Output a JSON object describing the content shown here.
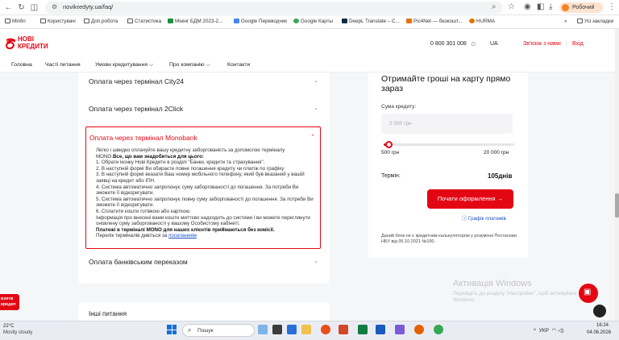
{
  "browser": {
    "url": "novikredyty.ua/faq/",
    "profile_label": "Робочий",
    "bookmarks": [
      "Minfin",
      "Користувачі",
      "Доп.робота",
      "Статистика",
      "Мінінг БДМ 2023-2...",
      "Google Переводчик",
      "Google Карты",
      "DeepL Translate – C...",
      "Pic4Net — безкошт...",
      "HURMA"
    ],
    "bookmarks_more": "»",
    "all_bookmarks": "Усі закладки"
  },
  "site": {
    "logo_line1": "НОВІ",
    "logo_line2": "КРЕДИТИ",
    "phone": "0 800 301 008",
    "lang": "UA",
    "contact": "Зв'язок з нами",
    "separator": "|",
    "login": "Вхід",
    "nav": [
      "Головна",
      "Часті питання",
      "Умови кредитування ⌵",
      "Про компанію ⌵",
      "Контакти"
    ]
  },
  "faq": {
    "items": [
      {
        "title": "Оплата через термінал City24"
      },
      {
        "title": "Оплата через термінал 2Click"
      },
      {
        "title": "Оплата банківським переказом"
      }
    ],
    "expanded": {
      "title": "Оплата через термінал Monobank",
      "intro": "Легко і швидко оплачуйте вашу кредитну заборгованість за допомогою терміналу MONO.",
      "intro_bold": "Все, що вам знадобиться для цього:",
      "steps": [
        "1. Обрати іконку Нові Кредити в розділі \"Банки, кредити та страхування\".",
        "2. В наступній формі Ви обираєте повне погашення кредиту чи платіж по графіку",
        "3. В наступній формі вказати Ваш номер мобільного телефону, який був вказаний у вашій заявці на кредит або ІПН.",
        "4. Система автоматично запропонує суму заборгованості до погашення. За потреби Ви зможете її відкоригувати.",
        "5. Система автоматично запропонує повну суму заборгованості до погашення. За потреби Ви зможете її відкоригувати.",
        "6. Сплатити кошти готівкою або карткою.",
        "Інформація про внесені вами кошти миттєво надходить до системи і ви можете переглянути оновлену суму заборгованості у вашому Особистому кабінеті."
      ],
      "bold_note": "Платежі в терміналі MONO для наших клієнтів приймаються без комісії.",
      "list_text": "Перелік терміналів дивіться за ",
      "list_link": "посиланням"
    },
    "other_questions": "Інші питання"
  },
  "calculator": {
    "title": "Отримайте гроші на карту прямо зараз",
    "sum_label": "Сума кредиту:",
    "sum_placeholder": "2 000 грн",
    "min": "500 грн",
    "max": "20 000 грн",
    "slider_fraction": 0.04,
    "term_label": "Термін:",
    "term_value": "105днів",
    "apply_button": "Почати оформлення →",
    "schedule_link": "Графік платежів",
    "disclaimer": "Даний блок не є кредитним калькулятором у розумінні Постанови НБУ від 05.10.2021 №100."
  },
  "float_left": "взяти кредит",
  "watermark": {
    "title": "Активація Windows",
    "text": "Перейдіть до розділу \"Настройки\", щоб активувати Windows."
  },
  "taskbar": {
    "temp": "22°C",
    "weather": "Mostly cloudy",
    "search": "Пошук",
    "lang": "УКР",
    "time": "16:24",
    "date": "04.06.2026"
  },
  "colors": {
    "brand_red": "#e30613",
    "link_blue": "#1a4fc4"
  }
}
